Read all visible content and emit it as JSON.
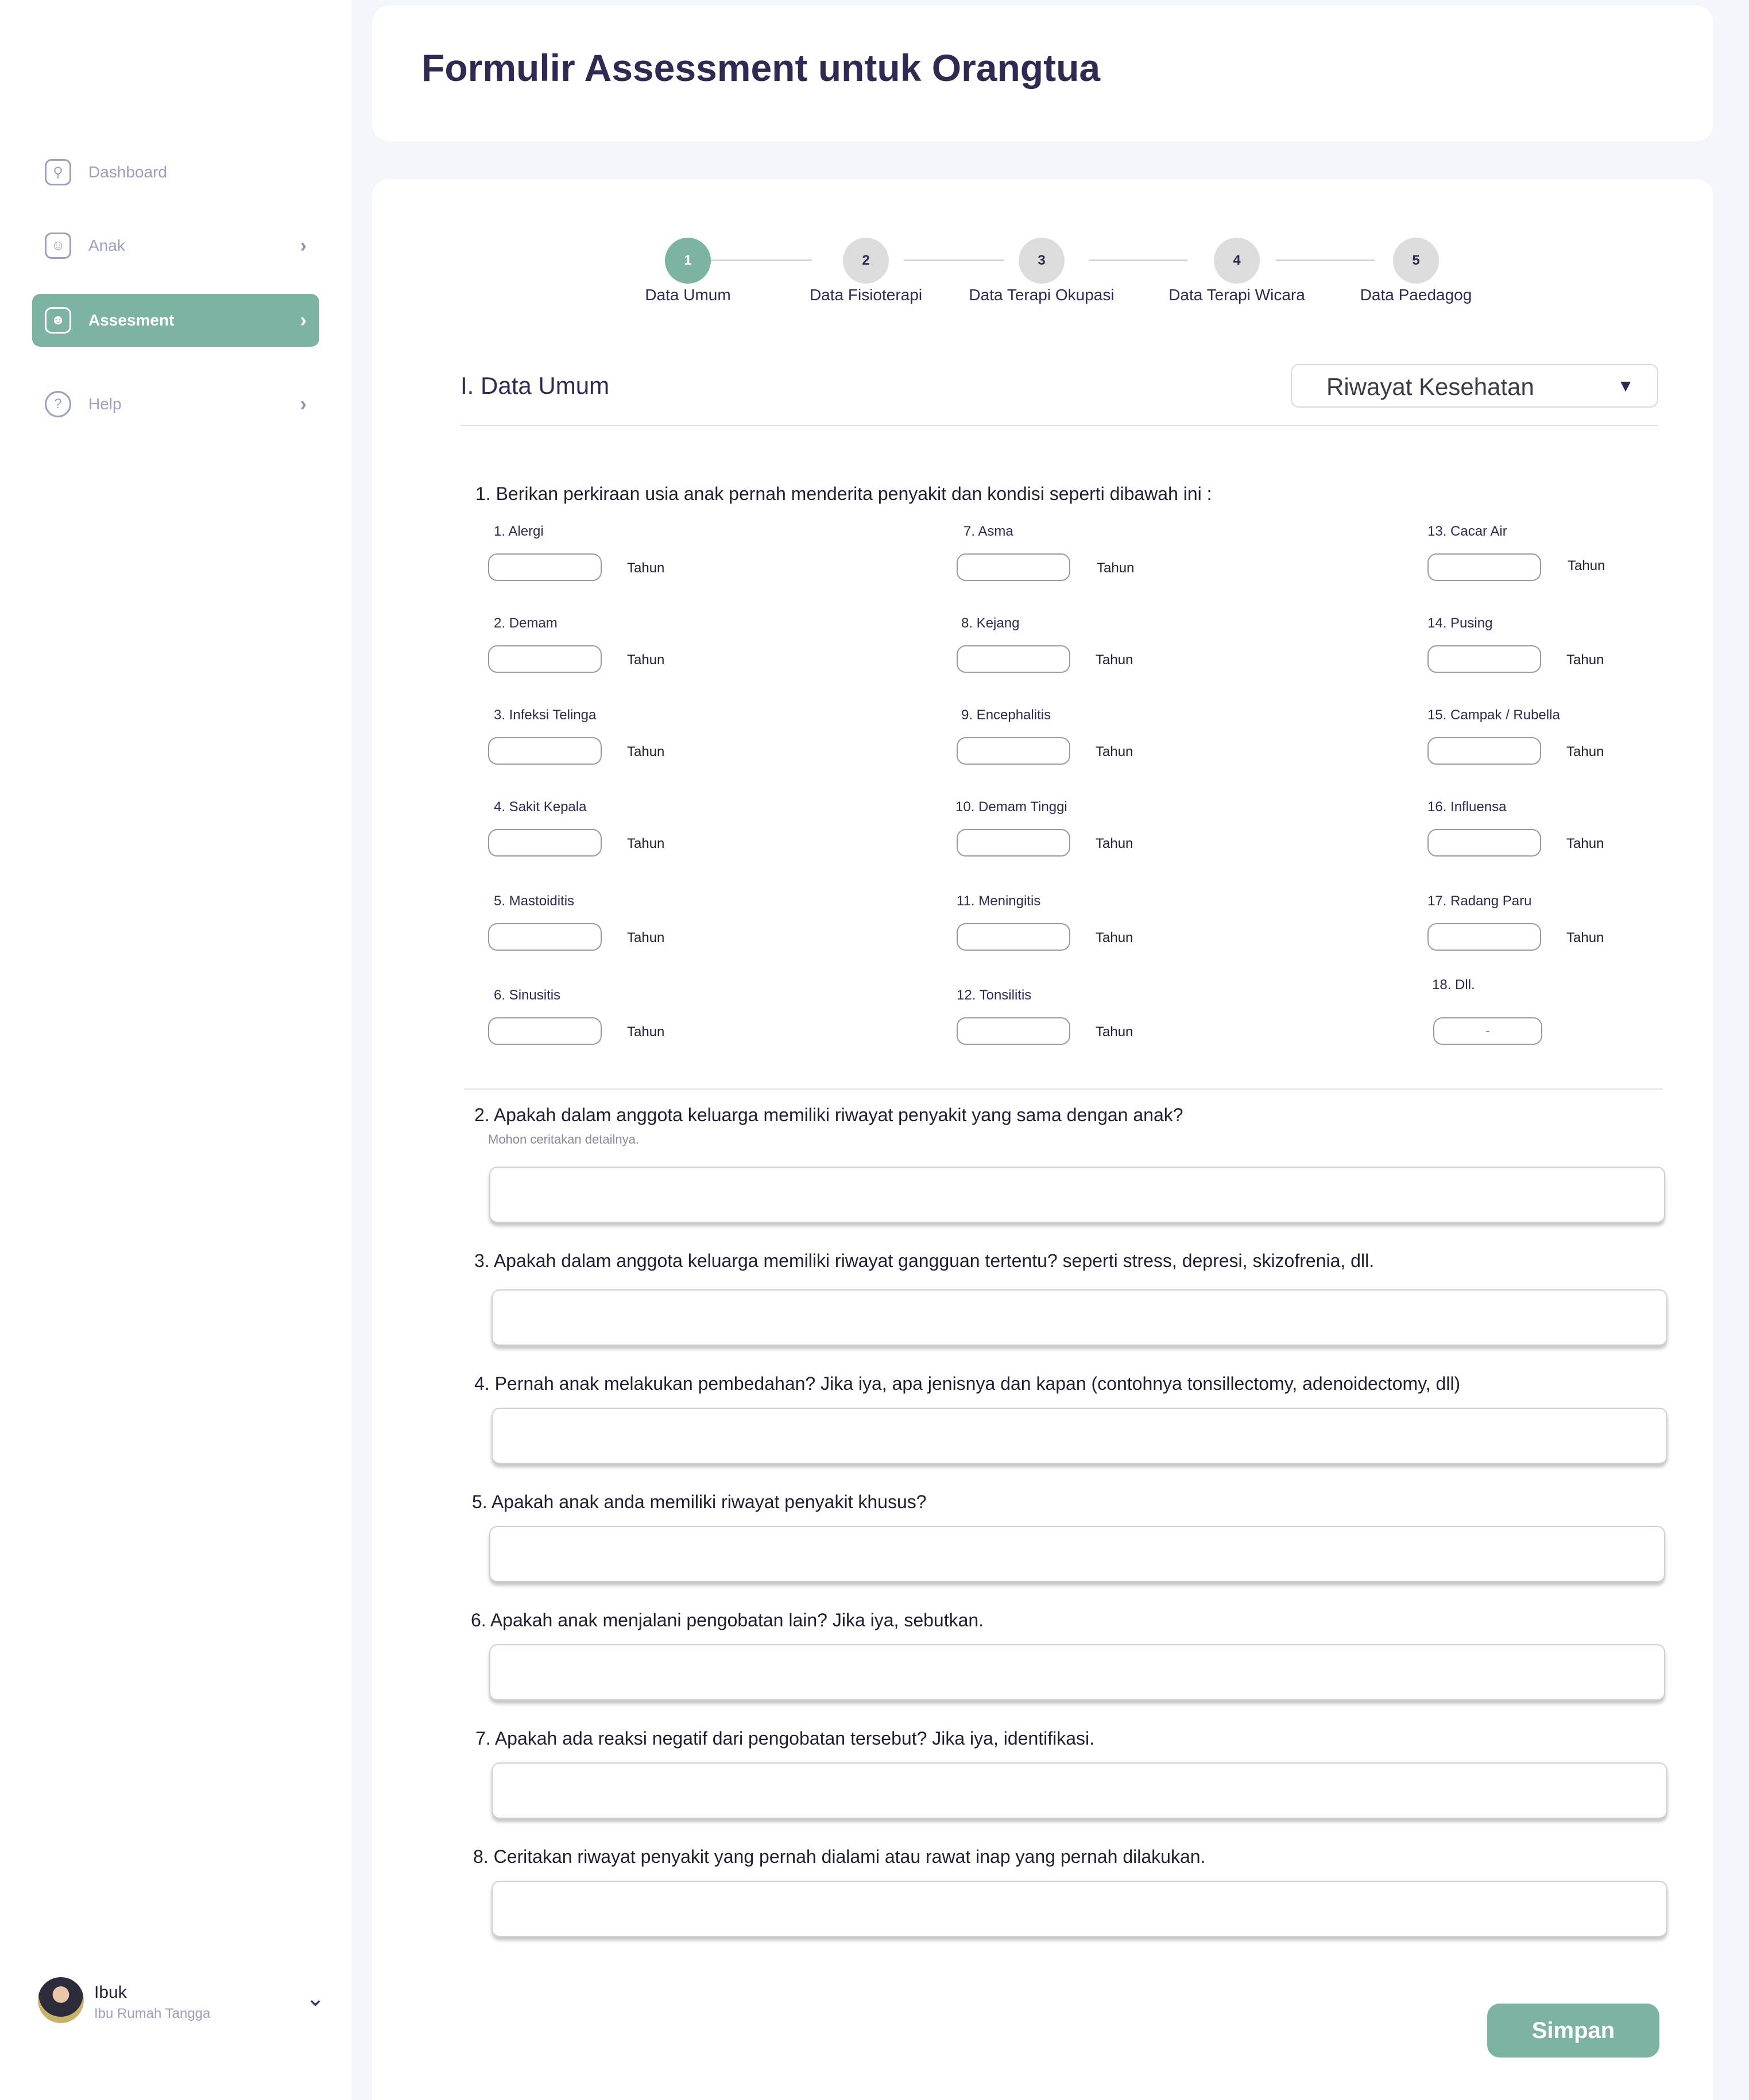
{
  "page": {
    "title": "Formulir Assessment untuk Orangtua"
  },
  "sidebar": {
    "items": [
      {
        "label": "Dashboard",
        "icon": "search-icon"
      },
      {
        "label": "Anak",
        "icon": "smile-icon"
      },
      {
        "label": "Assesment",
        "icon": "user-icon"
      },
      {
        "label": "Help",
        "icon": "help-icon"
      }
    ],
    "user": {
      "name": "Ibuk",
      "role": "Ibu Rumah Tangga"
    }
  },
  "stepper": {
    "steps": [
      {
        "number": "1",
        "label": "Data Umum"
      },
      {
        "number": "2",
        "label": "Data Fisioterapi"
      },
      {
        "number": "3",
        "label": "Data Terapi Okupasi"
      },
      {
        "number": "4",
        "label": "Data Terapi Wicara"
      },
      {
        "number": "5",
        "label": "Data Paedagog"
      }
    ],
    "active": 1
  },
  "section": {
    "title": "I. Data Umum",
    "dropdown_value": "Riwayat Kesehatan"
  },
  "question1": {
    "text": "1. Berikan perkiraan usia anak pernah menderita penyakit dan kondisi seperti dibawah ini :",
    "unit": "Tahun",
    "diseases": [
      "1. Alergi",
      "2. Demam",
      "3. Infeksi Telinga",
      "4. Sakit Kepala",
      "5. Mastoiditis",
      "6. Sinusitis",
      "7. Asma",
      "8. Kejang",
      "9. Encephalitis",
      "10. Demam Tinggi",
      "11. Meningitis",
      "12. Tonsilitis",
      "13. Cacar Air",
      "14. Pusing",
      "15. Campak / Rubella",
      "16. Influensa",
      "17. Radang Paru",
      "18. Dll."
    ],
    "other_placeholder": "-"
  },
  "questions": [
    {
      "text": "2. Apakah dalam anggota keluarga memiliki riwayat penyakit yang sama dengan anak?",
      "hint": "Mohon ceritakan detailnya."
    },
    {
      "text": "3. Apakah dalam anggota keluarga memiliki riwayat gangguan tertentu? seperti stress, depresi, skizofrenia, dll."
    },
    {
      "text": "4. Pernah anak melakukan pembedahan? Jika iya, apa jenisnya dan kapan (contohnya tonsillectomy, adenoidectomy, dll)"
    },
    {
      "text": "5. Apakah anak anda memiliki riwayat penyakit khusus?"
    },
    {
      "text": "6. Apakah anak menjalani pengobatan lain? Jika iya, sebutkan."
    },
    {
      "text": "7. Apakah ada reaksi negatif dari pengobatan tersebut? Jika iya, identifikasi."
    },
    {
      "text": "8. Ceritakan riwayat penyakit yang pernah dialami atau rawat inap yang pernah dilakukan."
    }
  ],
  "actions": {
    "save_label": "Simpan"
  },
  "colors": {
    "accent": "#7db3a2",
    "text": "#2e2a52",
    "muted": "#9aa0bd",
    "background": "#f3f6fb"
  }
}
